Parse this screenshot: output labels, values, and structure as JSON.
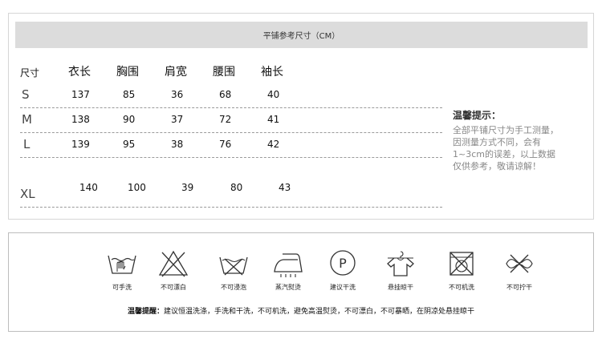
{
  "header": {
    "title": "平铺参考尺寸（CM）"
  },
  "table": {
    "headers": [
      "尺寸",
      "衣长",
      "胸围",
      "肩宽",
      "腰围",
      "袖长"
    ],
    "rows": [
      {
        "size": "S",
        "values": [
          "137",
          "85",
          "36",
          "68",
          "40"
        ]
      },
      {
        "size": "M",
        "values": [
          "138",
          "90",
          "37",
          "72",
          "41"
        ]
      },
      {
        "size": "L",
        "values": [
          "139",
          "95",
          "38",
          "76",
          "42"
        ]
      },
      {
        "size": "XL",
        "values": [
          "140",
          "100",
          "39",
          "80",
          "43"
        ]
      }
    ]
  },
  "tip": {
    "title": "温馨提示：",
    "lines": [
      "全部平铺尺寸为手工测量，",
      "因测量方式不同，会有",
      "1~3cm的误差，以上数据",
      "仅供参考，敬请谅解！"
    ]
  },
  "care": {
    "items": [
      {
        "icon": "hand-wash-icon",
        "label": "可手洗"
      },
      {
        "icon": "no-bleach-icon",
        "label": "不可漂白"
      },
      {
        "icon": "no-soak-icon",
        "label": "不可浸泡"
      },
      {
        "icon": "steam-iron-icon",
        "label": "蒸汽熨烫"
      },
      {
        "icon": "dry-clean-icon",
        "label": "建议干洗"
      },
      {
        "icon": "hang-dry-icon",
        "label": "悬挂晾干"
      },
      {
        "icon": "no-machine-wash-icon",
        "label": "不可机洗"
      },
      {
        "icon": "no-wring-icon",
        "label": "不可拧干"
      }
    ],
    "note_label": "温馨提醒：",
    "note_text": "建议恒温洗涤，手洗和干洗，不可机洗，避免高温熨烫，不可漂白，不可暴晒，在阴凉处悬挂晾干",
    "dry_clean_letter": "P"
  }
}
